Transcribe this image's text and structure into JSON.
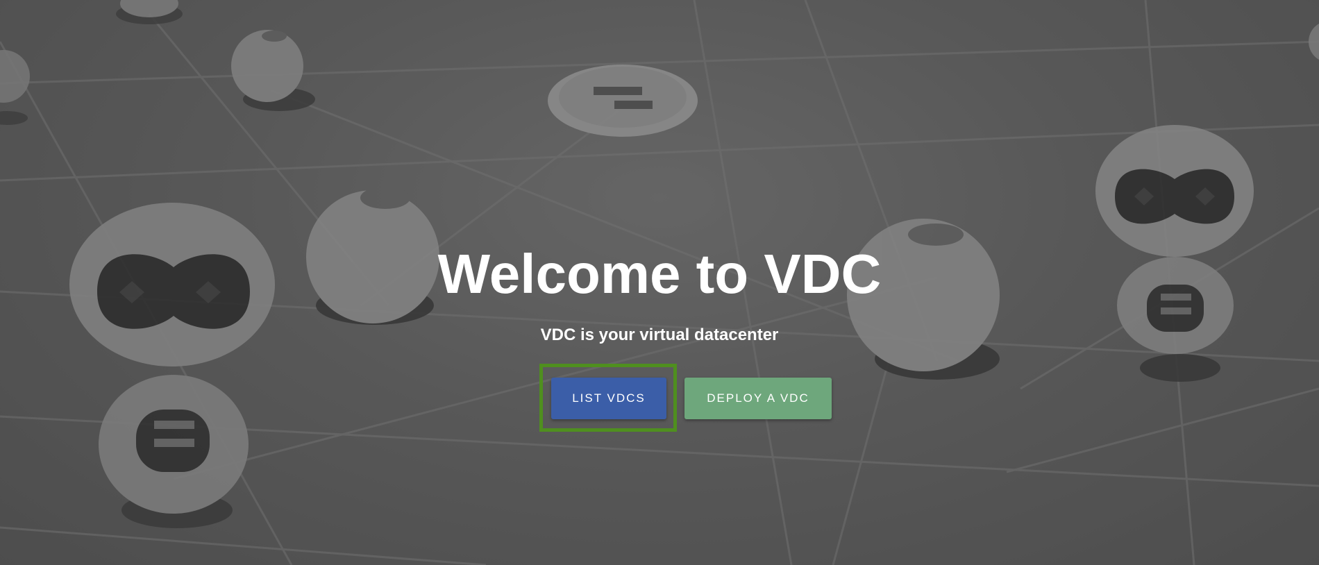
{
  "hero": {
    "title": "Welcome to VDC",
    "subtitle": "VDC is your virtual datacenter"
  },
  "actions": {
    "list_label": "LIST VDCS",
    "deploy_label": "DEPLOY A VDC"
  },
  "colors": {
    "list_button": "#3b5ea8",
    "deploy_button": "#6ea77c",
    "focus_outline": "#4f8f1f",
    "background": "#5d5d5d"
  }
}
